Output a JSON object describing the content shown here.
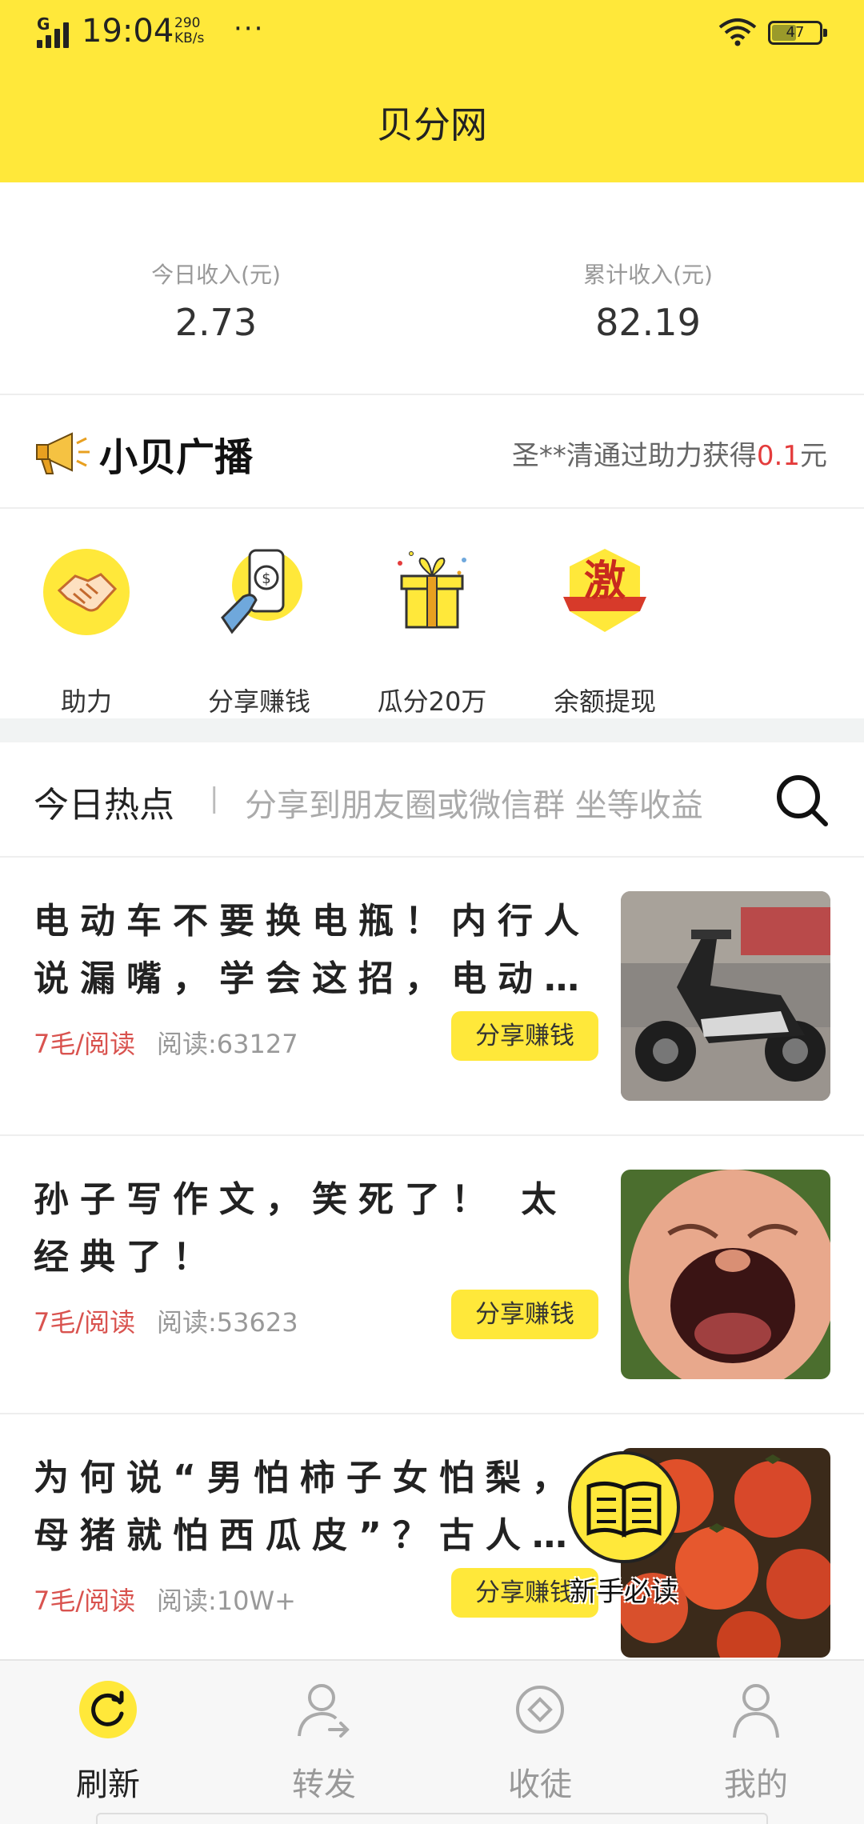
{
  "status_bar": {
    "network": "G",
    "time": "19:04",
    "speed_value": "290",
    "speed_unit": "KB/s",
    "more": "···",
    "battery": "47"
  },
  "header": {
    "title": "贝分网"
  },
  "income": {
    "today_label": "今日收入(元)",
    "today_value": "2.73",
    "total_label": "累计收入(元)",
    "total_value": "82.19"
  },
  "broadcast": {
    "title": "小贝广播",
    "message_prefix": "圣**清通过助力获得",
    "amount": "0.1",
    "message_suffix": "元"
  },
  "features": [
    {
      "label": "助力",
      "icon": "handshake-icon"
    },
    {
      "label": "分享赚钱",
      "icon": "phone-money-icon"
    },
    {
      "label": "瓜分20万",
      "icon": "gift-box-icon"
    },
    {
      "label": "余额提现",
      "icon": "withdraw-badge-icon"
    }
  ],
  "badge_text": "激",
  "hot": {
    "title": "今日热点",
    "separator": "|",
    "placeholder": "分享到朋友圈或微信群 坐等收益"
  },
  "articles": [
    {
      "title": "电动车不要换电瓶！内行人说漏嘴，学会这招，电动…",
      "rate": "7毛/阅读",
      "reads": "阅读:63127",
      "button": "分享赚钱"
    },
    {
      "title": "孙子写作文，笑死了！ 太经典了！",
      "rate": "7毛/阅读",
      "reads": "阅读:53623",
      "button": "分享赚钱"
    },
    {
      "title": "为何说“男怕柿子女怕梨，母猪就怕西瓜皮”？古人…",
      "rate": "7毛/阅读",
      "reads": "阅读:10W+",
      "button": "分享赚钱"
    }
  ],
  "guide": {
    "label": "新手必读"
  },
  "nav": [
    {
      "label": "刷新",
      "icon": "refresh-icon",
      "active": true
    },
    {
      "label": "转发",
      "icon": "user-forward-icon",
      "active": false
    },
    {
      "label": "收徒",
      "icon": "diamond-coin-icon",
      "active": false
    },
    {
      "label": "我的",
      "icon": "user-icon",
      "active": false
    }
  ],
  "colors": {
    "brand_yellow": "#FFE83A",
    "accent_red": "#e43c3c"
  }
}
